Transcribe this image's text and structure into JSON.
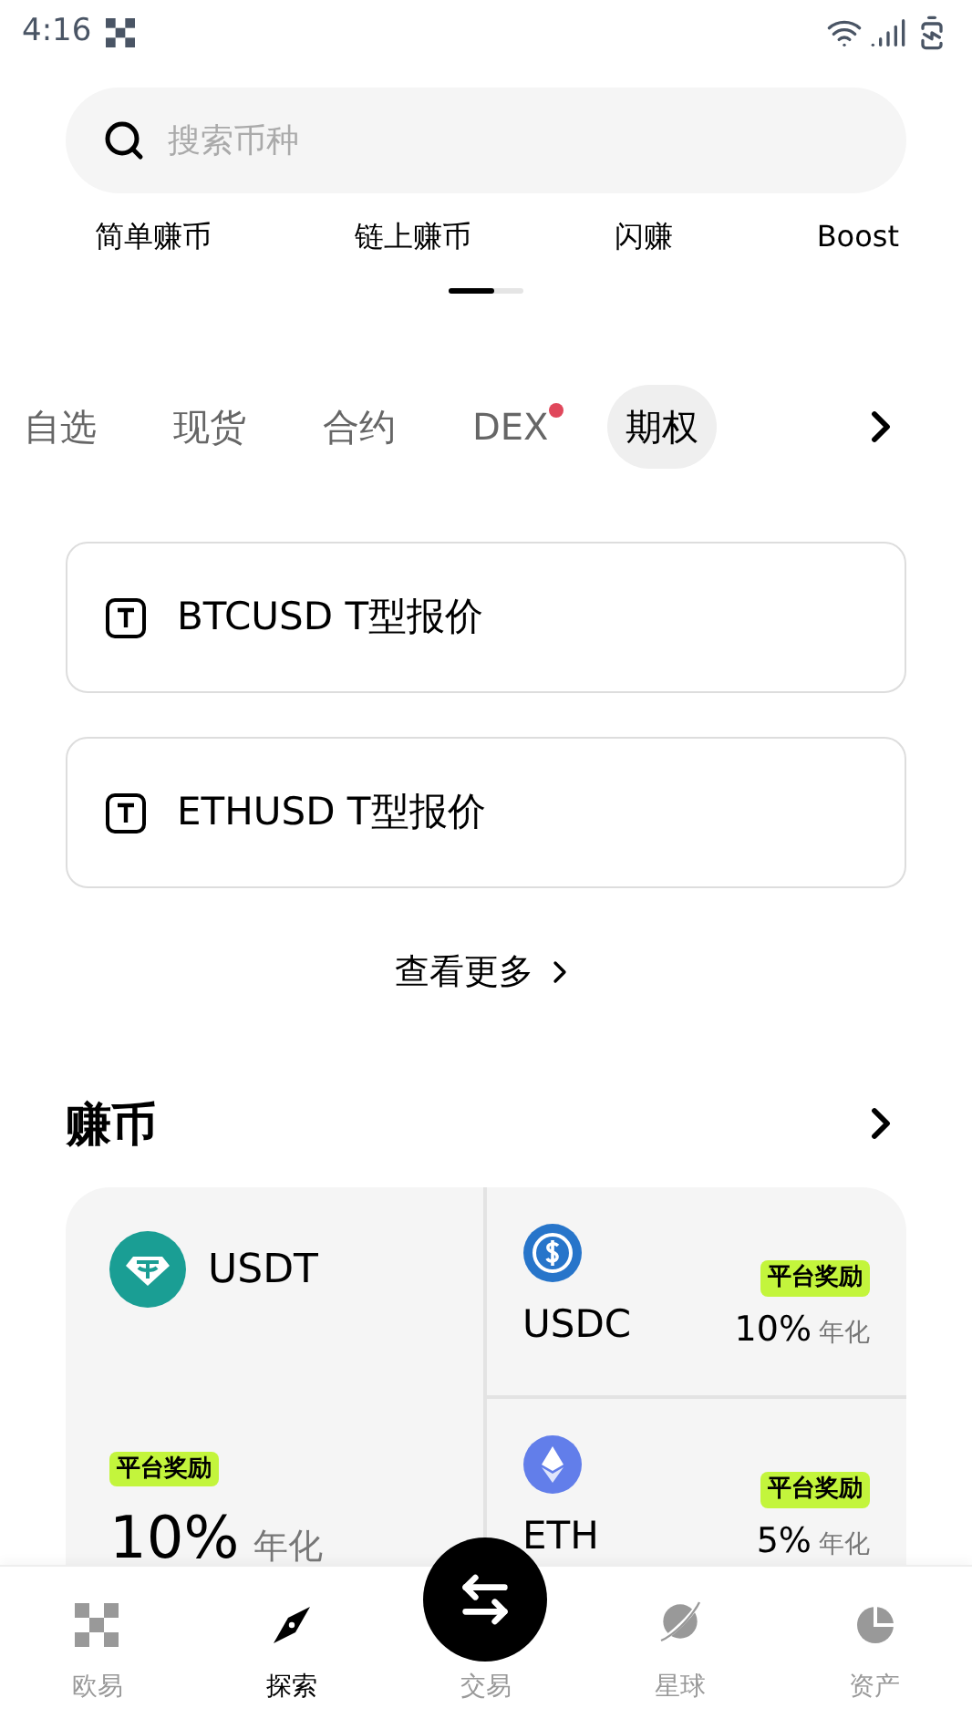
{
  "status_bar": {
    "time": "4:16"
  },
  "search": {
    "placeholder": "搜索币种"
  },
  "quick_links": [
    {
      "label": "简单赚币"
    },
    {
      "label": "链上赚币"
    },
    {
      "label": "闪赚"
    },
    {
      "label": "Boost"
    }
  ],
  "page_indicator": {
    "level": 0.6
  },
  "market_tabs": [
    {
      "label": "自选",
      "selected": false,
      "dot": false
    },
    {
      "label": "现货",
      "selected": false,
      "dot": false
    },
    {
      "label": "合约",
      "selected": false,
      "dot": false
    },
    {
      "label": "DEX",
      "selected": false,
      "dot": true
    },
    {
      "label": "期权",
      "selected": true,
      "dot": false
    }
  ],
  "option_cards": [
    {
      "label": "BTCUSD T型报价"
    },
    {
      "label": "ETHUSD T型报价"
    }
  ],
  "see_more": "查看更多",
  "earn": {
    "title": "赚币",
    "featured": {
      "coin": "USDT",
      "badge": "平台奖励",
      "rate": "10%",
      "rate_unit": "年化"
    },
    "items": [
      {
        "coin": "USDC",
        "badge": "平台奖励",
        "rate": "10%",
        "rate_unit": "年化",
        "color": "#2775ca"
      },
      {
        "coin": "ETH",
        "badge": "平台奖励",
        "rate": "5%",
        "rate_unit": "年化",
        "color": "#627eea"
      }
    ]
  },
  "bottom_nav": [
    {
      "label": "欧易",
      "kind": "logo",
      "selected": false
    },
    {
      "label": "探索",
      "kind": "compass",
      "selected": true
    },
    {
      "label": "交易",
      "kind": "swap",
      "selected": false
    },
    {
      "label": "星球",
      "kind": "planet",
      "selected": false
    },
    {
      "label": "资产",
      "kind": "pie",
      "selected": false
    }
  ]
}
